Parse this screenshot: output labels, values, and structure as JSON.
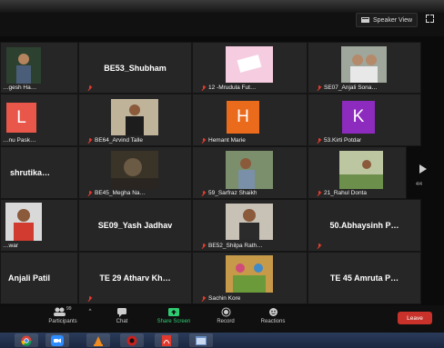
{
  "top_bar": {
    "speaker_view_label": "Speaker View"
  },
  "gallery": {
    "page_indicator": "4/4",
    "tiles": [
      {
        "name": "…gesh Ha…",
        "kind": "photo"
      },
      {
        "name": "BE53_Shubham",
        "kind": "text"
      },
      {
        "name": "12 -Mrudula Fut…",
        "kind": "photo"
      },
      {
        "name": "SE07_Anjali Sona…",
        "kind": "photo"
      },
      {
        "name": "…nu Pask…",
        "kind": "letter",
        "letter": "L",
        "color": "#e8574a"
      },
      {
        "name": "BE64_Arvind Talle",
        "kind": "photo"
      },
      {
        "name": "Hemant Marie",
        "kind": "letter",
        "letter": "H",
        "color": "#ea6b1c"
      },
      {
        "name": "53.Kirti Potdar",
        "kind": "letter",
        "letter": "K",
        "color": "#8e2bbf"
      },
      {
        "name": "shrutika…",
        "kind": "text"
      },
      {
        "name": "BE45_Megha Na…",
        "kind": "photo"
      },
      {
        "name": "59_Sarfraz Shaikh",
        "kind": "photo"
      },
      {
        "name": "21_Rahul Donta",
        "kind": "photo"
      },
      {
        "name": "…war",
        "kind": "photo"
      },
      {
        "name": "SE09_Yash Jadhav",
        "kind": "text"
      },
      {
        "name": "BE52_Shilpa Rath…",
        "kind": "photo"
      },
      {
        "name": "50.Abhaysinh P…",
        "kind": "text"
      },
      {
        "name": "Anjali Patil",
        "kind": "text"
      },
      {
        "name": "TE 29 Atharv Kh…",
        "kind": "text"
      },
      {
        "name": "Sachin Kore",
        "kind": "photo"
      },
      {
        "name": "TE 45 Amruta P…",
        "kind": "text"
      }
    ]
  },
  "toolbar": {
    "participants_label": "Participants",
    "participants_count": "99",
    "chat_label": "Chat",
    "share_label": "Share Screen",
    "record_label": "Record",
    "reactions_label": "Reactions",
    "leave_label": "Leave"
  },
  "taskbar": {
    "apps": [
      "chrome-icon",
      "zoom-icon",
      "vlc-icon",
      "media-icon",
      "pdf-icon",
      "window-icon"
    ]
  },
  "colors": {
    "leave": "#c8322a",
    "share_screen": "#2ecc71",
    "mute": "#e03b2e"
  }
}
